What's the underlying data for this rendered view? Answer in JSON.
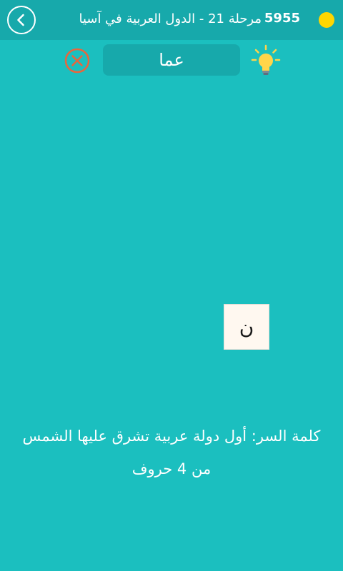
{
  "header": {
    "title": "مرحلة 21 - الدول العربية في آسيا",
    "coins": "5955"
  },
  "answer": {
    "current_text": "عما"
  },
  "tiles": [
    {
      "letter": "ن"
    }
  ],
  "clue": {
    "line1": "كلمة السر: أول دولة عربية تشرق عليها الشمس",
    "line2": "من 4 حروف"
  },
  "icons": {
    "back": "chevron-left-icon",
    "coin": "coin-icon",
    "clear": "close-circle-icon",
    "hint": "lightbulb-icon"
  },
  "colors": {
    "background": "#1bbfbf",
    "header": "#17a9ab",
    "coin": "#ffd600",
    "clear_icon": "#e8663d",
    "hint_icon": "#ffd54a",
    "tile": "#fff8f0"
  }
}
